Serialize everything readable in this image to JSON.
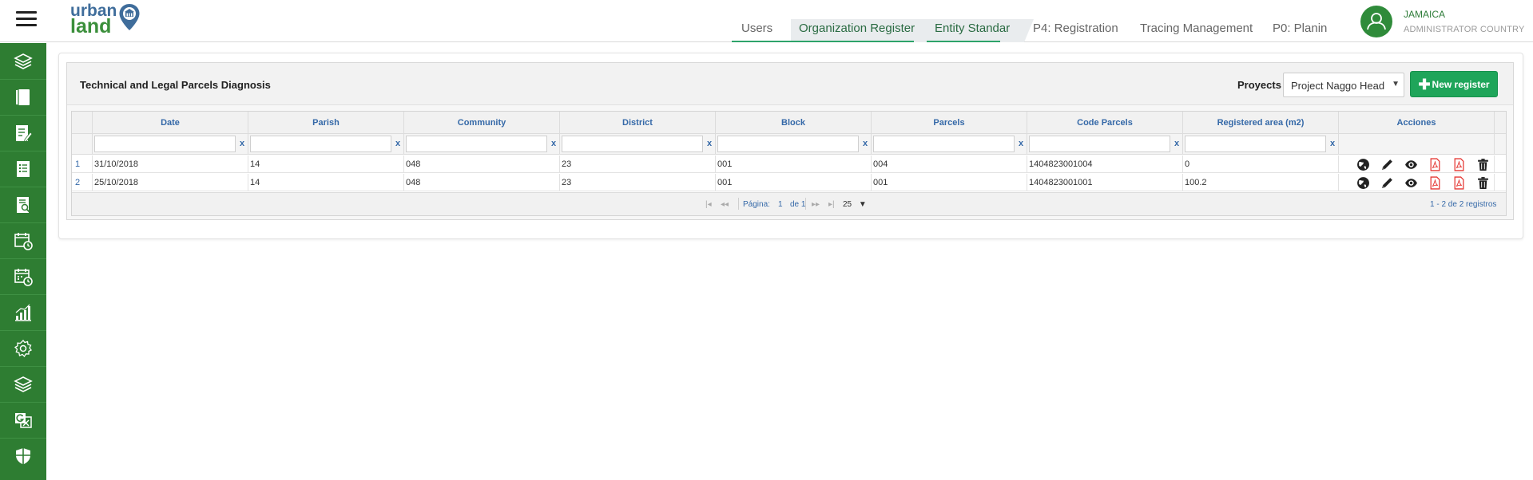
{
  "header": {
    "logo_word1": "urban",
    "logo_word2": "land",
    "tabs": [
      {
        "label": "Users",
        "active": false
      },
      {
        "label": "Organization Register",
        "active": true
      },
      {
        "label": "Entity Standar",
        "active": true
      },
      {
        "label": "P4: Registration",
        "active": false
      },
      {
        "label": "Tracing Management",
        "active": false
      },
      {
        "label": "P0: Planin",
        "active": false
      }
    ],
    "user": {
      "country": "JAMAICA",
      "role": "ADMINISTRATOR COUNTRY"
    }
  },
  "sidebar": {
    "items": [
      {
        "icon": "layers-icon"
      },
      {
        "icon": "book-icon"
      },
      {
        "icon": "document-edit-icon"
      },
      {
        "icon": "document-list-icon"
      },
      {
        "icon": "document-search-icon"
      },
      {
        "icon": "calendar-clock-icon"
      },
      {
        "icon": "calendar-schedule-icon"
      },
      {
        "icon": "bar-chart-icon"
      },
      {
        "icon": "gear-icon"
      },
      {
        "icon": "layers-icon"
      },
      {
        "icon": "translate-icon"
      },
      {
        "icon": "shield-icon"
      }
    ]
  },
  "panel": {
    "title": "Technical and Legal Parcels Diagnosis",
    "proyects_label": "Proyects",
    "proyects_value": "Project Naggo Head",
    "new_register": "New register"
  },
  "grid": {
    "columns": [
      "Date",
      "Parish",
      "Community",
      "District",
      "Block",
      "Parcels",
      "Code Parcels",
      "Registered area (m2)",
      "Acciones"
    ],
    "filter_clear": "x",
    "rows": [
      {
        "n": "1",
        "date": "31/10/2018",
        "parish": "14",
        "community": "048",
        "district": "23",
        "block": "001",
        "parcels": "004",
        "code": "1404823001004",
        "area": "0"
      },
      {
        "n": "2",
        "date": "25/10/2018",
        "parish": "14",
        "community": "048",
        "district": "23",
        "block": "001",
        "parcels": "001",
        "code": "1404823001001",
        "area": "100.2"
      }
    ],
    "action_icons": [
      "globe-icon",
      "pencil-icon",
      "eye-icon",
      "pdf-icon",
      "pdf-icon",
      "trash-icon"
    ]
  },
  "pager": {
    "first": "|◂",
    "prev": "◂◂",
    "page_label": "Página:",
    "page_value": "1",
    "of_label": "de 1",
    "next": "▸▸",
    "last": "▸|",
    "page_size": "25",
    "summary": "1 - 2 de 2 registros"
  },
  "colors": {
    "sidebar": "#2e7d32",
    "accent": "#1fa55a",
    "link": "#3569a8",
    "pdf": "#e53935"
  }
}
